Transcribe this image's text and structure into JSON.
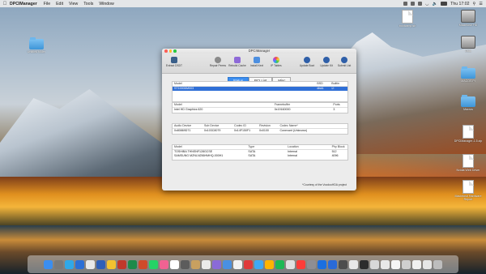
{
  "menubar": {
    "app_name": "DPCIManager",
    "menus": [
      "File",
      "Edit",
      "View",
      "Tools",
      "Window"
    ],
    "clock": "Thu 17:02"
  },
  "desktop_icons": [
    {
      "label": "Untitled folder",
      "kind": "folder"
    },
    {
      "label": "bootcamp.sh",
      "kind": "doc"
    },
    {
      "label": "Macintosh HD",
      "kind": "disk"
    },
    {
      "label": "Data",
      "kind": "disk"
    },
    {
      "label": "MACOS PI",
      "kind": "folder"
    },
    {
      "label": "Macros",
      "kind": "folder"
    },
    {
      "label": "DPCIManager-1.5.zip",
      "kind": "doc"
    },
    {
      "label": "Nvidia Web Driver",
      "kind": "doc"
    },
    {
      "label": "Macintosh Hardware Report",
      "kind": "doc"
    }
  ],
  "window": {
    "title": "DPCIManager",
    "toolbar_left": "Extract DSDT",
    "toolbar_center": [
      "Repair Perms",
      "Rebuild Cache",
      "Install Kext",
      "IP Tables"
    ],
    "toolbar_right": [
      "Update Boot",
      "Update Kit",
      "Submit List"
    ],
    "tabs": [
      "Status",
      "PCI List",
      "Misc"
    ],
    "active_tab": "Status",
    "disk_table": {
      "headers": [
        "Model",
        "BSD",
        "Builtin"
      ],
      "rows": [
        {
          "model": "ST1000DM003",
          "bsd": "disk1",
          "builtin": "☑"
        }
      ]
    },
    "gpu_table": {
      "headers": [
        "Model",
        "Framebuffer",
        "Ports"
      ],
      "rows": [
        {
          "model": "Intel HD Graphics 620",
          "framebuffer": "0x19160000",
          "ports": "3"
        }
      ]
    },
    "audio_table": {
      "headers": [
        "Audio Device",
        "Sub Device",
        "Codec ID",
        "Revision",
        "Codec Name*"
      ],
      "rows": [
        {
          "audio_device": "0x80869D71",
          "sub_device": "0x103C8079",
          "codec_id": "0x14F150F1",
          "revision": "0x0100",
          "codec_name": "Conexant (Unknown)"
        }
      ]
    },
    "storage_table": {
      "headers": [
        "Model",
        "Type",
        "Location",
        "Phy Block"
      ],
      "rows": [
        {
          "model": "TOSHIBA THNSNF128GCSE",
          "type": "SATA",
          "location": "Internal",
          "phy_block": "512"
        },
        {
          "model": "SAMSUNG MZNLN256HMHQ-000H1",
          "type": "SATA",
          "location": "Internal",
          "phy_block": "4096"
        }
      ]
    },
    "credit": "*Courtesy of the VoodooHDA project"
  },
  "dock_count": 38
}
